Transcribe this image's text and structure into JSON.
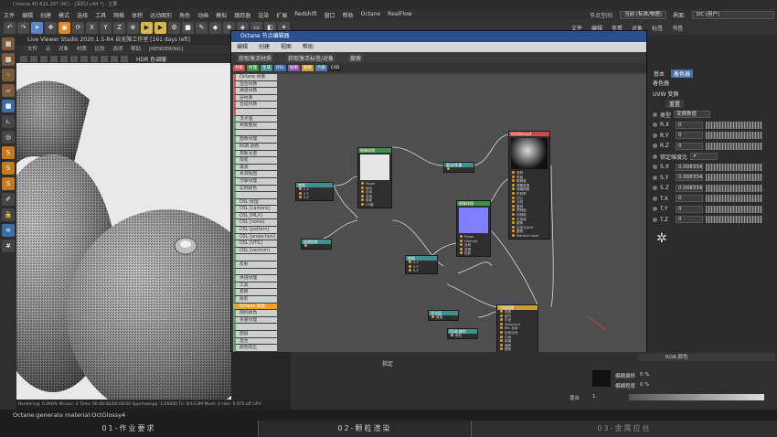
{
  "titlebar": "Cinema 4D R21.207 (RC) - [耳机2.c4d *] - 主要",
  "menubar": [
    "文件",
    "编辑",
    "创建",
    "模式",
    "选择",
    "工具",
    "网格",
    "体积",
    "运动图形",
    "角色",
    "动画",
    "模拟",
    "跟踪器",
    "渲染",
    "扩展",
    "Redshift",
    "窗口",
    "帮助",
    "Octane",
    "RealFlow"
  ],
  "menu_right": {
    "node_space_label": "节点空间:",
    "node_space_value": "当前 (标准/物理)",
    "layout_label": "界面:",
    "layout_value": "DC (用户)"
  },
  "toolbar_axes": [
    "X",
    "Y",
    "Z"
  ],
  "toolbar_right": [
    "文件",
    "编辑",
    "查看",
    "对象",
    "标签",
    "书签"
  ],
  "viewer": {
    "title": "Live Viewer Studio 2020.1.5-R4 自无限工作室 [161 days left]",
    "menu": [
      "文件",
      "云",
      "对象",
      "材质",
      "比较",
      "选项",
      "帮助",
      "[RENDERING]"
    ],
    "mode": "HDR 色调暖",
    "status": "Rendering: 0.000%  Ms/sec: 0   Time: 00:00:00/00:00:00   Spp/maxspp: 1/16000   Tri: 0/1/13M   Mesh: 4   Hair: 0   RTX:off   GPU"
  },
  "nodewin": {
    "title": "Octane 节点编辑器",
    "menu": [
      "编辑",
      "创建",
      "视图",
      "帮助"
    ],
    "buttons": [
      "获取激活材质",
      "获取激活标签/对象",
      "搜索"
    ],
    "tags": [
      {
        "label": "材质",
        "color": "#c84a4a"
      },
      {
        "label": "纹理",
        "color": "#3f8f4a"
      },
      {
        "label": "生成",
        "color": "#3f8f8f"
      },
      {
        "label": "OSL",
        "color": "#3a6fb0"
      },
      {
        "label": "贴图",
        "color": "#8a4aa8"
      },
      {
        "label": "发射",
        "color": "#c8a03a"
      },
      {
        "label": "介质",
        "color": "#4a7ab0"
      },
      {
        "label": "C4D",
        "color": "#2a2a2a"
      }
    ],
    "list": [
      {
        "label": "Octane 材质",
        "kind": "mat"
      },
      {
        "label": "混合材质",
        "kind": "mat"
      },
      {
        "label": "通道材质",
        "kind": "mat"
      },
      {
        "label": "层材质",
        "kind": "mat"
      },
      {
        "label": "合成材质",
        "kind": "mat"
      },
      {
        "label": "",
        "kind": "mat"
      },
      {
        "label": "浮点值",
        "kind": "tex"
      },
      {
        "label": "材质图层",
        "kind": "tex"
      },
      {
        "label": "",
        "kind": "tex"
      },
      {
        "label": "图像纹理",
        "kind": "tex"
      },
      {
        "label": "RGB 颜色",
        "kind": "tex"
      },
      {
        "label": "高斯光谱",
        "kind": "tex"
      },
      {
        "label": "渐变",
        "kind": "tex"
      },
      {
        "label": "噪波",
        "kind": "tex"
      },
      {
        "label": "衰减贴图",
        "kind": "tex"
      },
      {
        "label": "污垢纹理",
        "kind": "tex"
      },
      {
        "label": "实例颜色",
        "kind": "tex"
      },
      {
        "label": "",
        "kind": "tex"
      },
      {
        "label": "OSL 纹理",
        "kind": "tex"
      },
      {
        "label": "OSL [camera]",
        "kind": "tex"
      },
      {
        "label": "OSL [MLX]",
        "kind": "tex"
      },
      {
        "label": "OSL [noise]",
        "kind": "tex"
      },
      {
        "label": "OSL [pattern]",
        "kind": "tex"
      },
      {
        "label": "OSL [projection]",
        "kind": "tex"
      },
      {
        "label": "OSL [UTIL]",
        "kind": "tex"
      },
      {
        "label": "OSL [vectron]",
        "kind": "tex"
      },
      {
        "label": "",
        "kind": "tex"
      },
      {
        "label": "反射",
        "kind": "tex"
      },
      {
        "label": "",
        "kind": "tex"
      },
      {
        "label": "烘焙纹理",
        "kind": "tex"
      },
      {
        "label": "工具",
        "kind": "tex"
      },
      {
        "label": "变换",
        "kind": "tex"
      },
      {
        "label": "投影",
        "kind": "tex"
      },
      {
        "label": "Octane 渐变",
        "kind": "sel"
      },
      {
        "label": "随机颜色",
        "kind": "tex"
      },
      {
        "label": "多重纹理",
        "kind": "tex"
      },
      {
        "label": "",
        "kind": "tex"
      },
      {
        "label": "图层",
        "kind": "tex"
      },
      {
        "label": "混合",
        "kind": "tex"
      },
      {
        "label": "颜色校正",
        "kind": "tex"
      },
      {
        "label": "余弦混合",
        "kind": "tex"
      },
      {
        "label": "",
        "kind": "tex"
      },
      {
        "label": "卡通渐变",
        "kind": "tex"
      },
      {
        "label": "侧面",
        "kind": "tex"
      },
      {
        "label": "其他纹理",
        "kind": "tex"
      }
    ],
    "nodes": {
      "glossy": {
        "title": "OctGlossy4",
        "rows": [
          "漫射",
          "镜面",
          "粗糙度",
          "薄膜宽度",
          "薄膜指数",
          "折射率",
          "凹凸",
          "法线",
          "置换",
          "透明度",
          "伪阴影",
          "仅背面",
          "圆角",
          "自定义AOV",
          "圆角",
          "Material layer"
        ]
      },
      "image": {
        "title": "图像纹理",
        "rows": [
          "Power",
          "伽马",
          "反转",
          "变换",
          "投影",
          "UV集"
        ]
      },
      "normal": {
        "title": "图像纹理",
        "rows": [
          "Power",
          "Gamma",
          "反转",
          "变换",
          "投影"
        ]
      },
      "transform1": {
        "title": "变换",
        "rows": [
          "S.X",
          "S.Y",
          "S.Z"
        ]
      },
      "transform2": {
        "title": "变换",
        "rows": [
          "S.X",
          "S.Y",
          "S.Z"
        ]
      },
      "multiply": {
        "title": "乘法/多重",
        "rows": [
          ""
        ]
      },
      "uvw": {
        "title": "纹理投影",
        "rows": [
          ""
        ]
      },
      "float": {
        "title": "浮点值",
        "rows": [
          "数值"
        ]
      },
      "rgb": {
        "title": "RGB 颜色",
        "rows": [
          "颜色"
        ]
      },
      "dirt": {
        "title": "污垢纹理",
        "rows": [
          "强度",
          "细节",
          "半径",
          "Tolerance",
          "Mix 反射",
          "反转法线",
          "中间",
          "倍增",
          "偏移",
          "圆角",
          "置换强度"
        ]
      }
    }
  },
  "attr": {
    "tabs": [
      "基本",
      "着色器"
    ],
    "section": "着色器",
    "subsection": "UVW 变换",
    "reset": "重置",
    "type_label": "类型",
    "type_value": "变换数值",
    "rows": [
      {
        "label": "R.X",
        "value": "0"
      },
      {
        "label": "R.Y",
        "value": "0"
      },
      {
        "label": "R.Z",
        "value": "0"
      },
      {
        "label": "锁定维度比",
        "value": "✔"
      },
      {
        "label": "S.X",
        "value": "0.008334"
      },
      {
        "label": "S.Y",
        "value": "0.008334"
      },
      {
        "label": "S.Z",
        "value": "0.008334"
      },
      {
        "label": "T.X",
        "value": "0"
      },
      {
        "label": "T.Y",
        "value": "0"
      },
      {
        "label": "T.Z",
        "value": "0"
      }
    ]
  },
  "bottom": {
    "rgb_label": "RGB 颜色",
    "label": "指定",
    "blur_label": "模糊偏移",
    "blur_value": "0 %",
    "blur_scale_label": "模糊程度",
    "blur_scale_value": "0 %",
    "mix_label": "混合",
    "mix_value": "1."
  },
  "footer": {
    "status": "Octane:generate material:OctGlossy4",
    "tabs": [
      "01-作业要求",
      "02-颗粒渲染",
      "03-金属拉丝"
    ]
  }
}
